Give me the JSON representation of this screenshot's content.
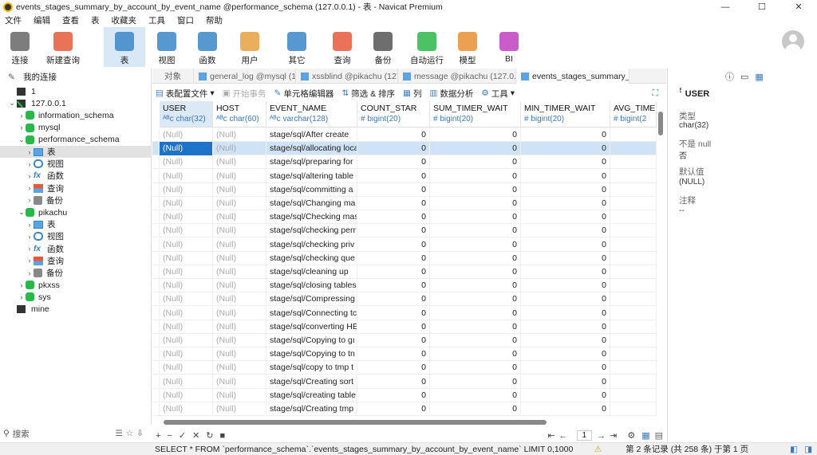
{
  "window": {
    "title": "events_stages_summary_by_account_by_event_name @performance_schema (127.0.0.1) - 表 - Navicat Premium",
    "min": "—",
    "max": "☐",
    "close": "✕"
  },
  "menu": [
    "文件",
    "编辑",
    "查看",
    "表",
    "收藏夹",
    "工具",
    "窗口",
    "帮助"
  ],
  "toolbar": [
    {
      "label": "连接",
      "icon": "connection-icon"
    },
    {
      "label": "新建查询",
      "icon": "new-query-icon"
    },
    {
      "label": "表",
      "icon": "table-icon",
      "active": true
    },
    {
      "label": "视图",
      "icon": "view-icon"
    },
    {
      "label": "函数",
      "icon": "function-icon"
    },
    {
      "label": "用户",
      "icon": "user-icon"
    },
    {
      "label": "其它",
      "icon": "other-icon"
    },
    {
      "label": "查询",
      "icon": "query-icon"
    },
    {
      "label": "备份",
      "icon": "backup-icon"
    },
    {
      "label": "自动运行",
      "icon": "automation-icon"
    },
    {
      "label": "模型",
      "icon": "model-icon"
    },
    {
      "label": "BI",
      "icon": "bi-icon"
    }
  ],
  "sidebar": {
    "header": "我的连接",
    "search_placeholder": "搜索",
    "items": [
      {
        "label": "1",
        "level": 0,
        "type": "conn"
      },
      {
        "label": "127.0.0.1",
        "level": 0,
        "type": "conn-green",
        "expanded": true
      },
      {
        "label": "information_schema",
        "level": 1,
        "type": "db"
      },
      {
        "label": "mysql",
        "level": 1,
        "type": "db"
      },
      {
        "label": "performance_schema",
        "level": 1,
        "type": "db",
        "expanded": true
      },
      {
        "label": "表",
        "level": 2,
        "type": "tbl",
        "selected": true
      },
      {
        "label": "视图",
        "level": 2,
        "type": "view"
      },
      {
        "label": "函数",
        "level": 2,
        "type": "fx"
      },
      {
        "label": "查询",
        "level": 2,
        "type": "q"
      },
      {
        "label": "备份",
        "level": 2,
        "type": "bk"
      },
      {
        "label": "pikachu",
        "level": 1,
        "type": "db",
        "expanded": true
      },
      {
        "label": "表",
        "level": 2,
        "type": "tbl"
      },
      {
        "label": "视图",
        "level": 2,
        "type": "view"
      },
      {
        "label": "函数",
        "level": 2,
        "type": "fx"
      },
      {
        "label": "查询",
        "level": 2,
        "type": "q"
      },
      {
        "label": "备份",
        "level": 2,
        "type": "bk"
      },
      {
        "label": "pkxss",
        "level": 1,
        "type": "db"
      },
      {
        "label": "sys",
        "level": 1,
        "type": "db"
      },
      {
        "label": "mine",
        "level": 0,
        "type": "conn"
      }
    ]
  },
  "tabs": [
    {
      "label": "对象"
    },
    {
      "label": "general_log @mysql (127...."
    },
    {
      "label": "xssblind @pikachu (127.0...."
    },
    {
      "label": "message @pikachu (127.0...."
    },
    {
      "label": "events_stages_summary_b...",
      "active": true
    }
  ],
  "subtoolbar": {
    "config": "表配置文件",
    "begin": "开始事务",
    "editor": "单元格编辑器",
    "filter": "筛选 & 排序",
    "columns": "列",
    "analysis": "数据分析",
    "tools": "工具"
  },
  "grid": {
    "columns": [
      {
        "name": "USER",
        "type": "char(32)"
      },
      {
        "name": "HOST",
        "type": "char(60)"
      },
      {
        "name": "EVENT_NAME",
        "type": "varchar(128)"
      },
      {
        "name": "COUNT_STAR",
        "type": "bigint(20)"
      },
      {
        "name": "SUM_TIMER_WAIT",
        "type": "bigint(20)"
      },
      {
        "name": "MIN_TIMER_WAIT",
        "type": "bigint(20)"
      },
      {
        "name": "AVG_TIME",
        "type": "bigint(2"
      }
    ],
    "null_text": "(Null)",
    "rows": [
      "stage/sql/After create",
      "stage/sql/allocating loca",
      "stage/sql/preparing for",
      "stage/sql/altering table",
      "stage/sql/committing a",
      "stage/sql/Changing ma",
      "stage/sql/Checking mas",
      "stage/sql/checking perr",
      "stage/sql/checking priv",
      "stage/sql/checking que",
      "stage/sql/cleaning up",
      "stage/sql/closing tables",
      "stage/sql/Compressing",
      "stage/sql/Connecting tc",
      "stage/sql/converting HE",
      "stage/sql/Copying to gı",
      "stage/sql/Copying to tn",
      "stage/sql/copy to tmp t",
      "stage/sql/Creating sort",
      "stage/sql/creating table",
      "stage/sql/Creating tmp"
    ],
    "zero": "0"
  },
  "bottombar": {
    "page": "1"
  },
  "rightpanel": {
    "title": "USER",
    "type_label": "类型",
    "type_value": "char(32)",
    "notnull_label": "不是 null",
    "notnull_value": "否",
    "default_label": "默认值",
    "default_value": "(NULL)",
    "comment_label": "注释",
    "comment_value": "--"
  },
  "status": {
    "sql": "SELECT * FROM `performance_schema`.`events_stages_summary_by_account_by_event_name` LIMIT 0,1000",
    "record": "第 2 条记录 (共 258 条) 于第 1 页"
  }
}
